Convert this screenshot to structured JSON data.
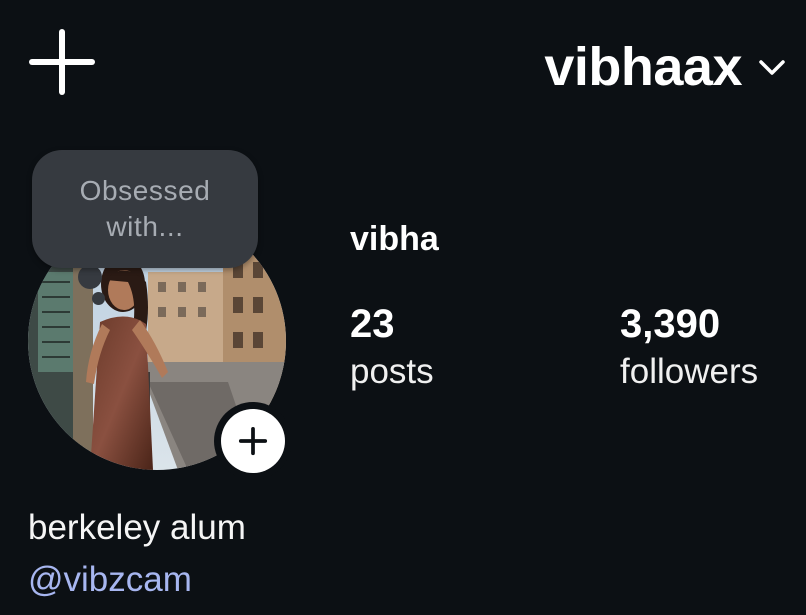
{
  "header": {
    "create_icon": "plus-icon",
    "username": "vibhaax",
    "switch_icon": "chevron-down-icon"
  },
  "note": {
    "text": "Obsessed with..."
  },
  "profile": {
    "display_name": "vibha",
    "add_story_icon": "plus-icon",
    "stats": {
      "posts": {
        "value": "23",
        "label": "posts"
      },
      "followers": {
        "value": "3,390",
        "label": "followers"
      }
    },
    "bio": "berkeley alum",
    "link": "@vibzcam"
  },
  "colors": {
    "background": "#0c1014",
    "text": "#f5f5f5",
    "note_bubble": "#363a40",
    "note_text": "#a7acb3",
    "link": "#a7b6f0"
  }
}
